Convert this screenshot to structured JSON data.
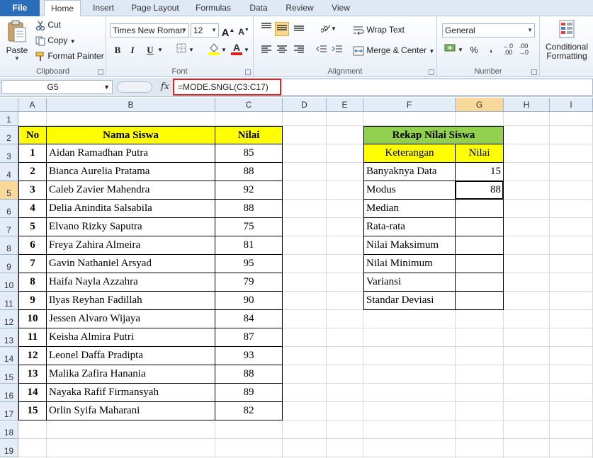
{
  "ribbon": {
    "tabs": [
      "File",
      "Home",
      "Insert",
      "Page Layout",
      "Formulas",
      "Data",
      "Review",
      "View"
    ],
    "clipboard": {
      "group_label": "Clipboard",
      "paste": "Paste",
      "cut": "Cut",
      "copy": "Copy",
      "format_painter": "Format Painter"
    },
    "font": {
      "group_label": "Font",
      "font_name": "Times New Roman",
      "font_size": "12",
      "bold": "B",
      "italic": "I",
      "underline": "U"
    },
    "alignment": {
      "group_label": "Alignment",
      "wrap_text": "Wrap Text",
      "merge_center": "Merge & Center"
    },
    "number": {
      "group_label": "Number",
      "format": "General",
      "percent": "%",
      "comma": ","
    },
    "styles": {
      "conditional_formatting": "Conditional Formatting"
    },
    "colors": {
      "file_tab": "#2a6ebb",
      "font_color": "#e02020",
      "highlight": "#ffff00"
    }
  },
  "formula_bar": {
    "name_box": "G5",
    "fx": "fx",
    "formula": "=MODE.SNGL(C3:C17)",
    "highlight_color": "#e02020"
  },
  "grid": {
    "columns": [
      "A",
      "B",
      "C",
      "D",
      "E",
      "F",
      "G",
      "H",
      "I"
    ],
    "rows": [
      "1",
      "2",
      "3",
      "4",
      "5",
      "6",
      "7",
      "8",
      "9",
      "10",
      "11",
      "12",
      "13",
      "14",
      "15",
      "16",
      "17",
      "18",
      "19"
    ],
    "selected_column": "G",
    "selected_row": "5"
  },
  "main_table": {
    "headers": {
      "no": "No",
      "name": "Nama Siswa",
      "score": "Nilai"
    },
    "rows": [
      {
        "no": "1",
        "name": "Aidan Ramadhan Putra",
        "score": "85"
      },
      {
        "no": "2",
        "name": "Bianca Aurelia Pratama",
        "score": "88"
      },
      {
        "no": "3",
        "name": "Caleb Zavier Mahendra",
        "score": "92"
      },
      {
        "no": "4",
        "name": "Delia Anindita Salsabila",
        "score": "88"
      },
      {
        "no": "5",
        "name": "Elvano Rizky Saputra",
        "score": "75"
      },
      {
        "no": "6",
        "name": "Freya Zahira Almeira",
        "score": "81"
      },
      {
        "no": "7",
        "name": "Gavin Nathaniel Arsyad",
        "score": "95"
      },
      {
        "no": "8",
        "name": "Haifa Nayla Azzahra",
        "score": "79"
      },
      {
        "no": "9",
        "name": "Ilyas Reyhan Fadillah",
        "score": "90"
      },
      {
        "no": "10",
        "name": "Jessen Alvaro Wijaya",
        "score": "84"
      },
      {
        "no": "11",
        "name": "Keisha Almira Putri",
        "score": "87"
      },
      {
        "no": "12",
        "name": "Leonel Daffa Pradipta",
        "score": "93"
      },
      {
        "no": "13",
        "name": "Malika Zafira Hanania",
        "score": "88"
      },
      {
        "no": "14",
        "name": "Nayaka Rafif Firmansyah",
        "score": "89"
      },
      {
        "no": "15",
        "name": "Orlin Syifa Maharani",
        "score": "82"
      }
    ],
    "header_color": "#ffff00"
  },
  "summary_table": {
    "title": "Rekap Nilai Siswa",
    "title_color": "#92d050",
    "header_color": "#ffff00",
    "headers": {
      "label": "Keterangan",
      "value": "Nilai"
    },
    "rows": [
      {
        "label": "Banyaknya Data",
        "value": "15"
      },
      {
        "label": "Modus",
        "value": "88"
      },
      {
        "label": "Median",
        "value": ""
      },
      {
        "label": "Rata-rata",
        "value": ""
      },
      {
        "label": "Nilai Maksimum",
        "value": ""
      },
      {
        "label": "Nilai Minimum",
        "value": ""
      },
      {
        "label": "Variansi",
        "value": ""
      },
      {
        "label": "Standar Deviasi",
        "value": ""
      }
    ]
  }
}
